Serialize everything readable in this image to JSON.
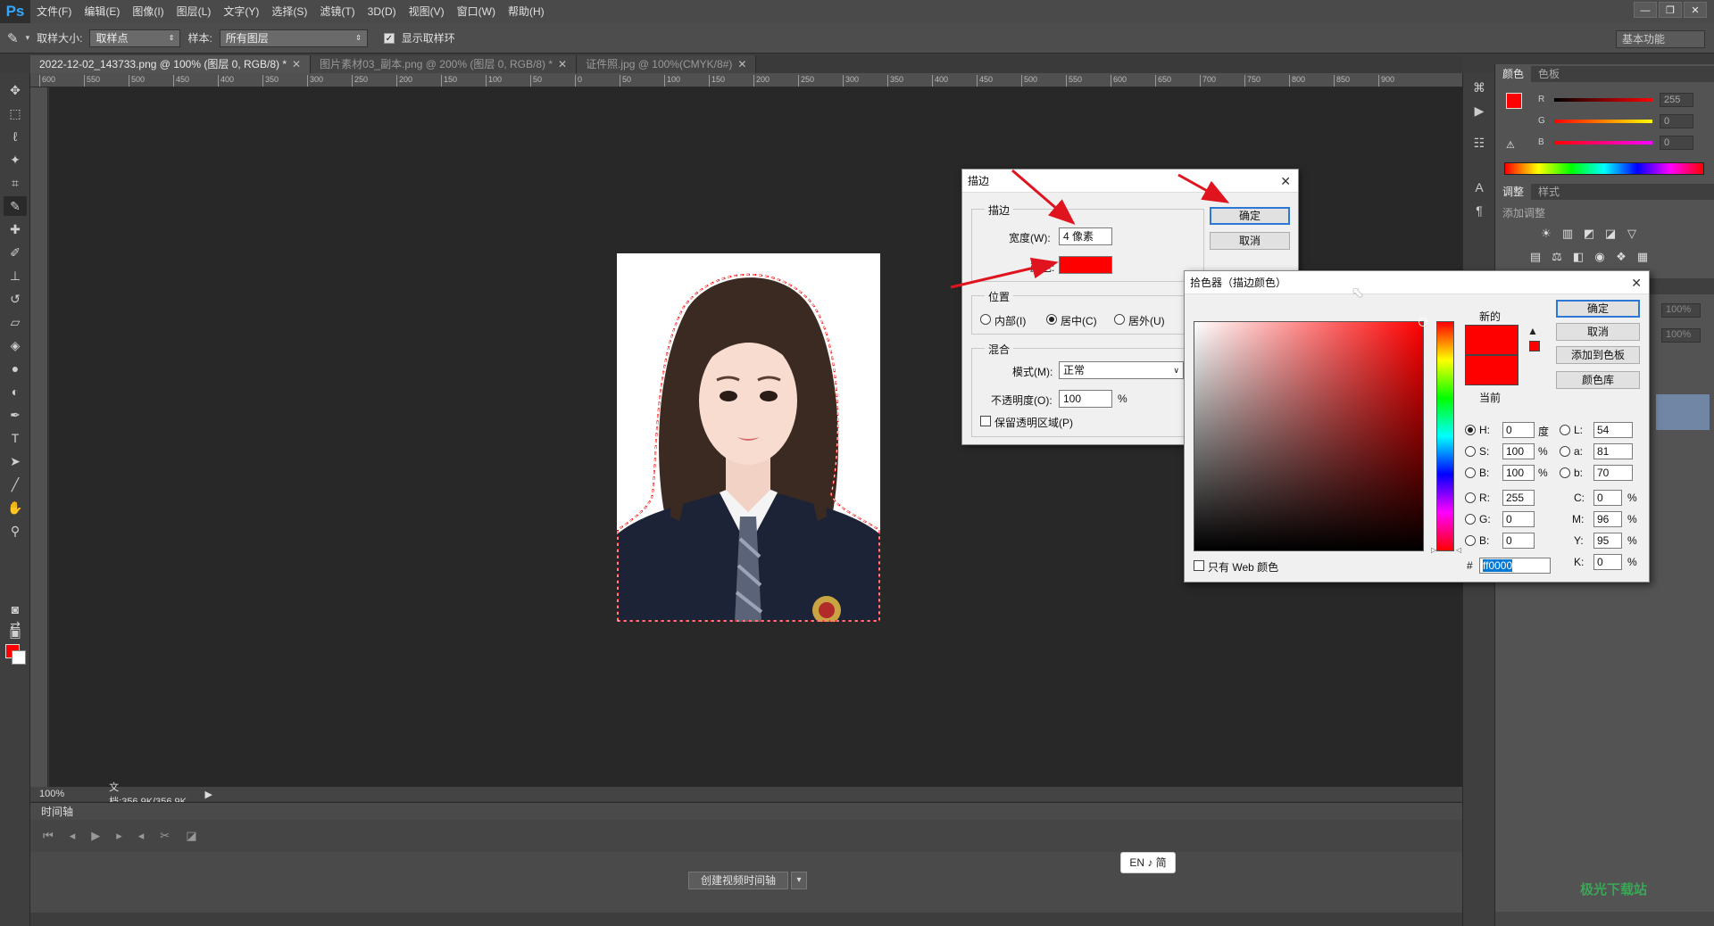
{
  "app": {
    "logo": "Ps",
    "menu": [
      "文件(F)",
      "编辑(E)",
      "图像(I)",
      "图层(L)",
      "文字(Y)",
      "选择(S)",
      "滤镜(T)",
      "3D(D)",
      "视图(V)",
      "窗口(W)",
      "帮助(H)"
    ],
    "window_controls": [
      "—",
      "❐",
      "✕"
    ]
  },
  "options_bar": {
    "sample_size_label": "取样大小:",
    "sample_size_value": "取样点",
    "sample_label": "样本:",
    "sample_value": "所有图层",
    "show_ring_label": "显示取样环",
    "show_ring_checked": true,
    "workspace": "基本功能"
  },
  "tabs": [
    {
      "label": "2022-12-02_143733.png @ 100% (图层 0, RGB/8) *",
      "active": true
    },
    {
      "label": "图片素材03_副本.png @ 200% (图层 0, RGB/8) *",
      "active": false
    },
    {
      "label": "证件照.jpg @ 100%(CMYK/8#)",
      "active": false
    }
  ],
  "ruler_ticks": [
    "600",
    "550",
    "500",
    "450",
    "400",
    "350",
    "300",
    "250",
    "200",
    "150",
    "100",
    "50",
    "0",
    "50",
    "100",
    "150",
    "200",
    "250",
    "300",
    "350",
    "400",
    "450",
    "500",
    "550",
    "600",
    "650",
    "700",
    "750",
    "800",
    "850",
    "900"
  ],
  "status": {
    "zoom": "100%",
    "doc": "文档:356.9K/356.9K"
  },
  "timeline": {
    "title": "时间轴",
    "create_button": "创建视频时间轴"
  },
  "ime": "EN ♪ 简",
  "right_panel": {
    "color_tabs": [
      "颜色",
      "色板"
    ],
    "sliders": [
      {
        "label": "R",
        "value": "255",
        "color": "#ff0000"
      },
      {
        "label": "G",
        "value": "0",
        "color": "#ffff00"
      },
      {
        "label": "B",
        "value": "0",
        "color": "#ff00ff"
      }
    ],
    "adjust_tabs": [
      "调整",
      "样式"
    ],
    "adjust_title": "添加调整",
    "layer_opacity": "100%",
    "layer_fill": "100%"
  },
  "stroke_dialog": {
    "title": "描边",
    "stroke_group": "描边",
    "width_label": "宽度(W):",
    "width_value": "4 像素",
    "color_label": "颜色:",
    "color_value": "#ff0000",
    "position_group": "位置",
    "inside_label": "内部(I)",
    "center_label": "居中(C)",
    "outside_label": "居外(U)",
    "blend_group": "混合",
    "mode_label": "模式(M):",
    "mode_value": "正常",
    "opacity_label": "不透明度(O):",
    "opacity_value": "100",
    "opacity_unit": "%",
    "preserve_label": "保留透明区域(P)",
    "ok": "确定",
    "cancel": "取消"
  },
  "picker_dialog": {
    "title": "拾色器（描边颜色）",
    "new_label": "新的",
    "current_label": "当前",
    "ok": "确定",
    "cancel": "取消",
    "add_swatch": "添加到色板",
    "color_library": "颜色库",
    "web_only": "只有 Web 颜色",
    "H": "0",
    "H_unit": "度",
    "S": "100",
    "S_unit": "%",
    "B": "100",
    "B_unit": "%",
    "R": "255",
    "G": "0",
    "Bv": "0",
    "L": "54",
    "a": "81",
    "b": "70",
    "C": "0",
    "M": "96",
    "Y": "95",
    "K": "0",
    "hex": "ff0000"
  },
  "watermark": "极光下载站"
}
